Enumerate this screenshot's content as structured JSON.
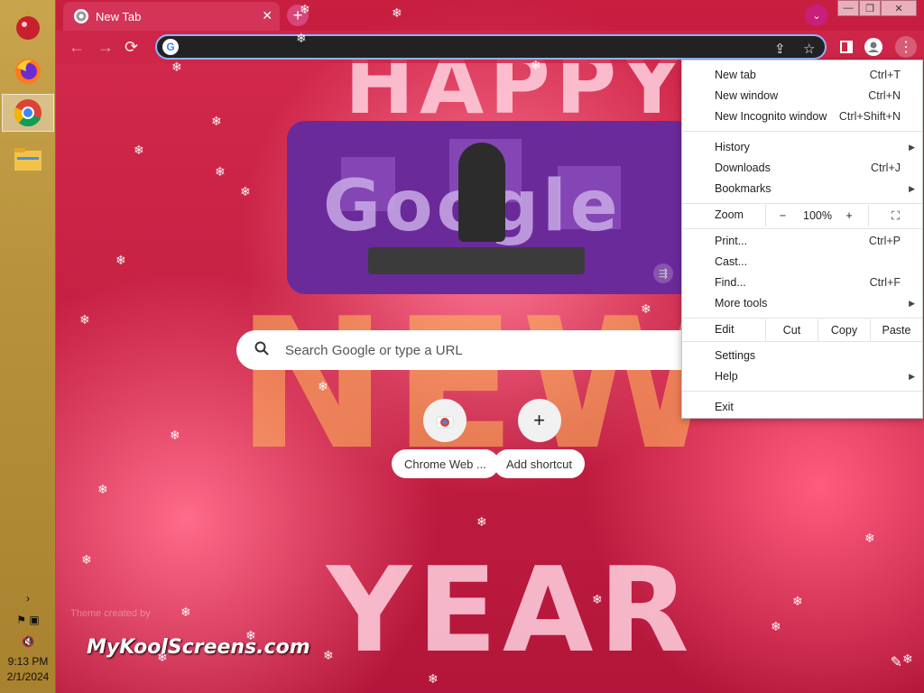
{
  "taskbar": {
    "clock_time": "9:13 PM",
    "clock_date": "2/1/2024",
    "icons": [
      "ornament-icon",
      "firefox-icon",
      "chrome-icon",
      "file-explorer-icon"
    ]
  },
  "tab": {
    "title": "New Tab"
  },
  "window_controls": {
    "minimize": "—",
    "restore": "❐",
    "close": "✕"
  },
  "omnibox": {
    "value": ""
  },
  "search": {
    "placeholder": "Search Google or type a URL"
  },
  "shortcuts": [
    {
      "label": "Chrome Web ..."
    },
    {
      "label": "Add shortcut"
    }
  ],
  "wallpaper_text": {
    "top": "HAPPY",
    "middle": "NEW",
    "bottom": "YEAR"
  },
  "watermark": "MyKoolScreens.com",
  "credit": "Theme created by",
  "doodle_text": "Google",
  "menu": {
    "new_tab": "New tab",
    "new_tab_sc": "Ctrl+T",
    "new_window": "New window",
    "new_window_sc": "Ctrl+N",
    "incognito": "New Incognito window",
    "incognito_sc": "Ctrl+Shift+N",
    "history": "History",
    "downloads": "Downloads",
    "downloads_sc": "Ctrl+J",
    "bookmarks": "Bookmarks",
    "zoom": "Zoom",
    "zoom_minus": "−",
    "zoom_value": "100%",
    "zoom_plus": "+",
    "print": "Print...",
    "print_sc": "Ctrl+P",
    "cast": "Cast...",
    "find": "Find...",
    "find_sc": "Ctrl+F",
    "more_tools": "More tools",
    "edit": "Edit",
    "cut": "Cut",
    "copy": "Copy",
    "paste": "Paste",
    "settings": "Settings",
    "help": "Help",
    "exit": "Exit"
  },
  "colors": {
    "theme": "#c71a3a",
    "accent": "#8fb3ff",
    "taskbar": "#b8923c"
  }
}
